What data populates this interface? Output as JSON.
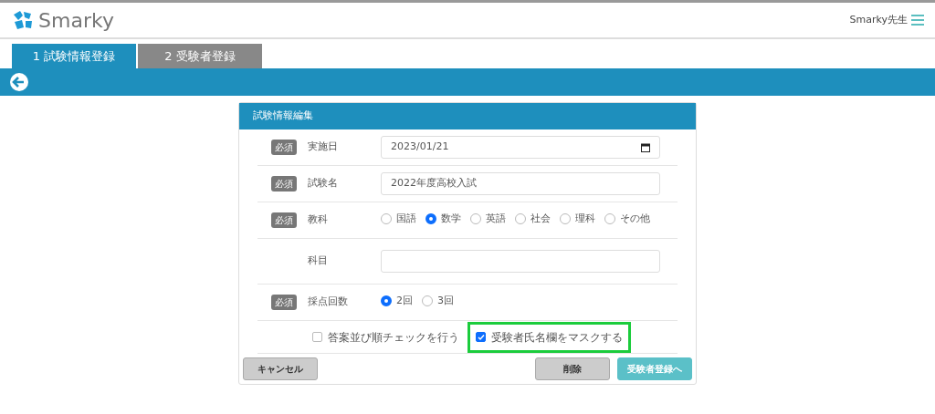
{
  "header": {
    "logo": "Smarky",
    "user": "Smarky先生"
  },
  "steps": [
    {
      "number": "1",
      "label": "試験情報登録",
      "selected": true
    },
    {
      "number": "2",
      "label": "受験者登録",
      "selected": false
    }
  ],
  "form": {
    "title": "試験情報編集",
    "rows": [
      {
        "kind": "date",
        "badge": "必須",
        "label": "実施日",
        "value": "2023/01/21"
      },
      {
        "kind": "text",
        "badge": "必須",
        "label": "試験名",
        "value": "2022年度高校入試"
      },
      {
        "kind": "radio",
        "badge": "必須",
        "label": "教科",
        "options": [
          {
            "label": "国語",
            "selected": false
          },
          {
            "label": "数学",
            "selected": true
          },
          {
            "label": "英語",
            "selected": false
          },
          {
            "label": "社会",
            "selected": false
          },
          {
            "label": "理科",
            "selected": false
          },
          {
            "label": "その他",
            "selected": false
          }
        ]
      },
      {
        "kind": "text",
        "label": "科目"
      },
      {
        "kind": "radio",
        "badge": "必須",
        "label": "採点回数",
        "options": [
          {
            "label": "2回",
            "selected": true
          },
          {
            "label": "3回",
            "selected": false
          }
        ]
      }
    ],
    "checkboxes": [
      {
        "label": "答案並び順チェックを行う",
        "checked": false,
        "highlighted": false
      },
      {
        "label": "受験者氏名欄をマスクする",
        "checked": true,
        "highlighted": true
      }
    ],
    "buttons": [
      {
        "kind": "cancel",
        "label": "キャンセル"
      },
      {
        "kind": "delete",
        "label": "削除"
      },
      {
        "kind": "next",
        "label": "受験者登録へ"
      }
    ]
  }
}
